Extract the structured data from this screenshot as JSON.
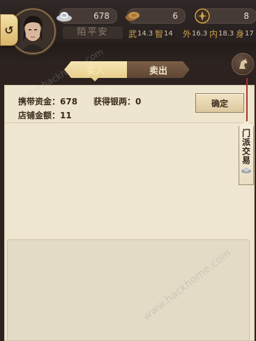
{
  "header": {
    "back_icon": "back-arrow-icon",
    "character_name": "陌平安",
    "resources": {
      "silver": "678",
      "coins": "6",
      "tokens": "8"
    },
    "stats": [
      {
        "glyph": "武",
        "value": "14.3"
      },
      {
        "glyph": "智",
        "value": "14"
      },
      {
        "glyph": "外",
        "value": "16.3"
      },
      {
        "glyph": "内",
        "value": "18.3"
      },
      {
        "glyph": "身",
        "value": "17"
      }
    ]
  },
  "tabs": {
    "buy": "买入",
    "sell": "卖出"
  },
  "trade_panel": {
    "carried_funds": "携带资金：678",
    "silver_gained": "获得银两：0",
    "shop_amount": "店铺金额：11",
    "confirm_label": "确定"
  },
  "side_tag": {
    "label": "门派交易"
  },
  "watermark": "www.hackhome.com",
  "colors": {
    "parchment": "#eee5cf",
    "header_bg": "#2c2320",
    "tab_active": "#f7e7b4",
    "tab_inactive": "#6e533e",
    "tag_string": "#a9332b"
  }
}
